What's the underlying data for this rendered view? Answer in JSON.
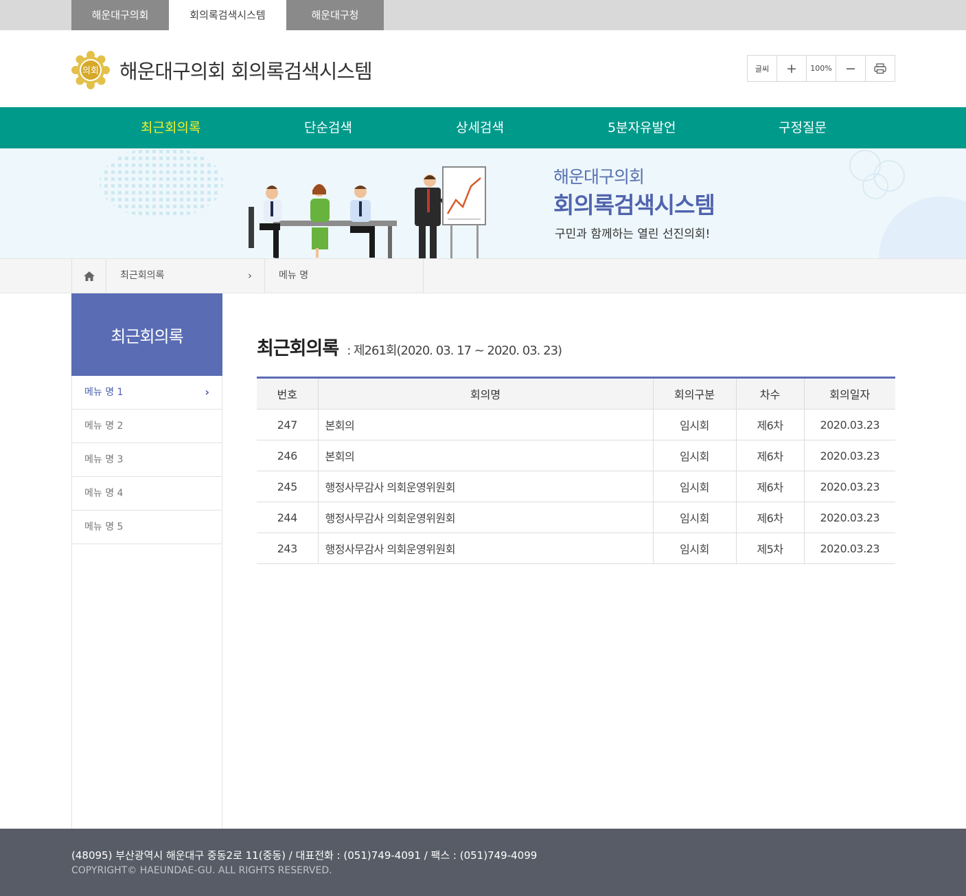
{
  "top_tabs": [
    "해운대구의회",
    "회의록검색시스템",
    "해운대구청"
  ],
  "header": {
    "emblem_text": "의회",
    "site_title": "해운대구의회 회의록검색시스템",
    "font_control": {
      "label": "글씨",
      "plus": "+",
      "zoom": "100%",
      "minus": "−"
    }
  },
  "gnb": {
    "items": [
      "최근회의록",
      "단순검색",
      "상세검색",
      "5분자유발언",
      "구정질문"
    ],
    "active_index": 0
  },
  "banner": {
    "line1": "해운대구의회",
    "line2": "회의록검색시스템",
    "line3": "구민과 함께하는 열린 선진의회!"
  },
  "breadcrumb": {
    "level1": "최근회의록",
    "level2": "메뉴 명"
  },
  "sidebar": {
    "title": "최근회의록",
    "items": [
      "메뉴 명 1",
      "메뉴 명 2",
      "메뉴 명 3",
      "메뉴 명 4",
      "메뉴 명 5"
    ],
    "active_index": 0
  },
  "content": {
    "title": "최근회의록",
    "subtitle": ": 제261회(2020. 03. 17 ~ 2020. 03. 23)",
    "columns": [
      "번호",
      "회의명",
      "회의구분",
      "차수",
      "회의일자"
    ],
    "rows": [
      [
        "247",
        "본회의",
        "임시회",
        "제6차",
        "2020.03.23"
      ],
      [
        "246",
        "본회의",
        "임시회",
        "제6차",
        "2020.03.23"
      ],
      [
        "245",
        "행정사무감사 의회운영위원회",
        "임시회",
        "제6차",
        "2020.03.23"
      ],
      [
        "244",
        "행정사무감사 의회운영위원회",
        "임시회",
        "제6차",
        "2020.03.23"
      ],
      [
        "243",
        "행정사무감사 의회운영위원회",
        "임시회",
        "제5차",
        "2020.03.23"
      ]
    ]
  },
  "footer": {
    "address": "(48095) 부산광역시 해운대구 중동2로 11(중동) / 대표전화 : (051)749-4091 / 팩스 : (051)749-4099",
    "copyright": "COPYRIGHT© HAEUNDAE-GU. ALL RIGHTS RESERVED."
  },
  "colors": {
    "nav_bg": "#009a8b",
    "nav_active": "#f6f22a",
    "accent": "#5a6cb4",
    "footer_bg": "#575c66"
  },
  "icons": {
    "home": "home-icon",
    "print": "print-icon",
    "emblem": "council-emblem-icon",
    "chevron": "chevron-right-icon"
  }
}
